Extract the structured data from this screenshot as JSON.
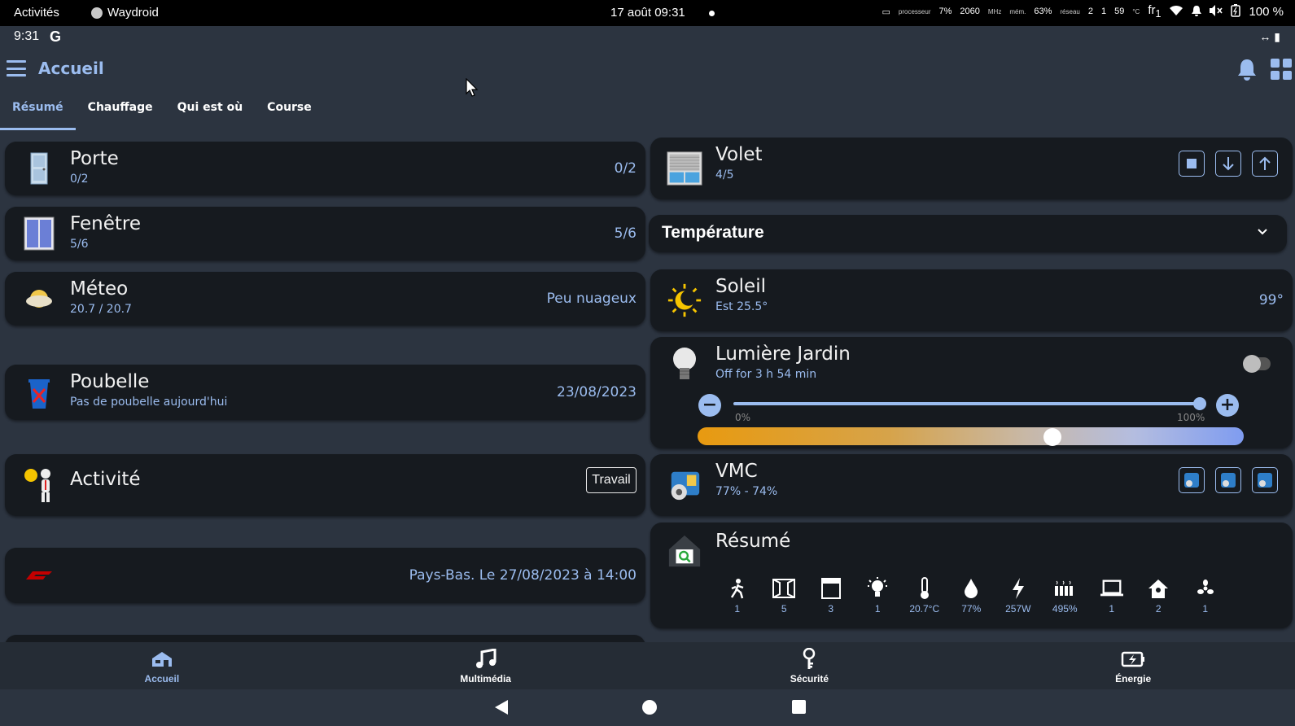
{
  "system_bar": {
    "activities": "Activités",
    "app_name": "Waydroid",
    "datetime": "17 août  09:31",
    "cpu_label": "processeur",
    "cpu_value": "7%",
    "freq": "2060",
    "freq_unit": "MHz",
    "mem_label": "mém.",
    "mem_value": "63%",
    "net_label": "réseau",
    "net_down": "2",
    "net_up": "1",
    "temp": "59",
    "temp_unit": "°C",
    "lang": "fr",
    "lang_sub": "1",
    "battery": "100 %"
  },
  "android_status": {
    "time": "9:31",
    "g": "G",
    "right_icons": "↔ ▮"
  },
  "header": {
    "title": "Accueil"
  },
  "tabs": [
    {
      "label": "Résumé",
      "active": true
    },
    {
      "label": "Chauffage"
    },
    {
      "label": "Qui est où"
    },
    {
      "label": "Course"
    }
  ],
  "left_cards": {
    "porte": {
      "name": "Porte",
      "sub": "0/2",
      "value": "0/2"
    },
    "fenetre": {
      "name": "Fenêtre",
      "sub": "5/6",
      "value": "5/6"
    },
    "meteo": {
      "name": "Méteo",
      "sub": "20.7 / 20.7",
      "value": "Peu nuageux"
    },
    "poubelle": {
      "name": "Poubelle",
      "sub": "Pas de poubelle aujourd'hui",
      "value": "23/08/2023"
    },
    "activite": {
      "name": "Activité",
      "button": "Travail"
    },
    "f1": {
      "value": "Pays-Bas. Le 27/08/2023 à 14:00"
    }
  },
  "right_cards": {
    "volet": {
      "name": "Volet",
      "sub": "4/5"
    },
    "temperature_header": "Température",
    "soleil": {
      "name": "Soleil",
      "sub": "Est 25.5°",
      "value": "99°"
    },
    "lumiere": {
      "name": "Lumière Jardin",
      "sub": "Off for 3 h 54 min",
      "min_label": "0%",
      "max_label": "100%",
      "brightness": 1.0,
      "color_temp": 0.66,
      "on": false
    },
    "vmc": {
      "name": "VMC",
      "sub": "77% - 74%"
    },
    "resume": {
      "name": "Résumé",
      "items": [
        {
          "icon": "person-walk-icon",
          "value": "1"
        },
        {
          "icon": "window-icon",
          "value": "5"
        },
        {
          "icon": "shutter-icon",
          "value": "3"
        },
        {
          "icon": "bulb-icon",
          "value": "1"
        },
        {
          "icon": "thermometer-icon",
          "value": "20.7°C"
        },
        {
          "icon": "water-drop-icon",
          "value": "77%"
        },
        {
          "icon": "flash-icon",
          "value": "257W"
        },
        {
          "icon": "radiator-icon",
          "value": "495%"
        },
        {
          "icon": "laptop-icon",
          "value": "1"
        },
        {
          "icon": "home-icon",
          "value": "2"
        },
        {
          "icon": "fan-icon",
          "value": "1"
        }
      ]
    }
  },
  "bottom_nav": [
    {
      "label": "Accueil",
      "active": true
    },
    {
      "label": "Multimédia"
    },
    {
      "label": "Sécurité"
    },
    {
      "label": "Énergie"
    }
  ],
  "colors": {
    "accent": "#9bbcef",
    "card_bg": "#161a1f",
    "page_bg": "#2c3440"
  }
}
